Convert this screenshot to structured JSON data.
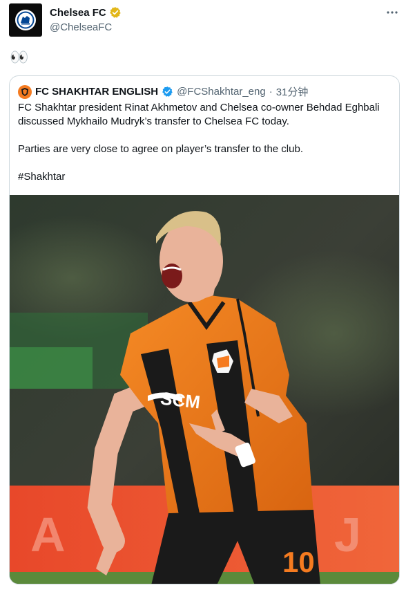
{
  "tweet": {
    "display_name": "Chelsea FC",
    "handle": "@ChelseaFC",
    "text": "👀"
  },
  "quote": {
    "display_name": "FC SHAKHTAR ENGLISH",
    "handle": "@FCShakhtar_eng",
    "separator": "·",
    "time": "31分钟",
    "paragraphs": [
      "FC Shakhtar president Rinat Akhmetov and Chelsea co-owner Behdad Eghbali discussed Mykhailo Mudryk’s transfer to Chelsea FC today.",
      "Parties are very close to agree on player’s transfer to the club.",
      "#Shakhtar"
    ],
    "image": {
      "sponsor_text": "SCM",
      "shirt_number": "10"
    }
  },
  "icons": {
    "verified": "verified-badge-icon",
    "more": "more-dots-icon"
  },
  "colors": {
    "verified_blue": "#1d9bf0",
    "verified_gold": "#e2b719",
    "text_primary": "#0f1419",
    "text_secondary": "#536471",
    "border": "#cfd9de",
    "shakhtar_orange": "#f07d1d"
  }
}
